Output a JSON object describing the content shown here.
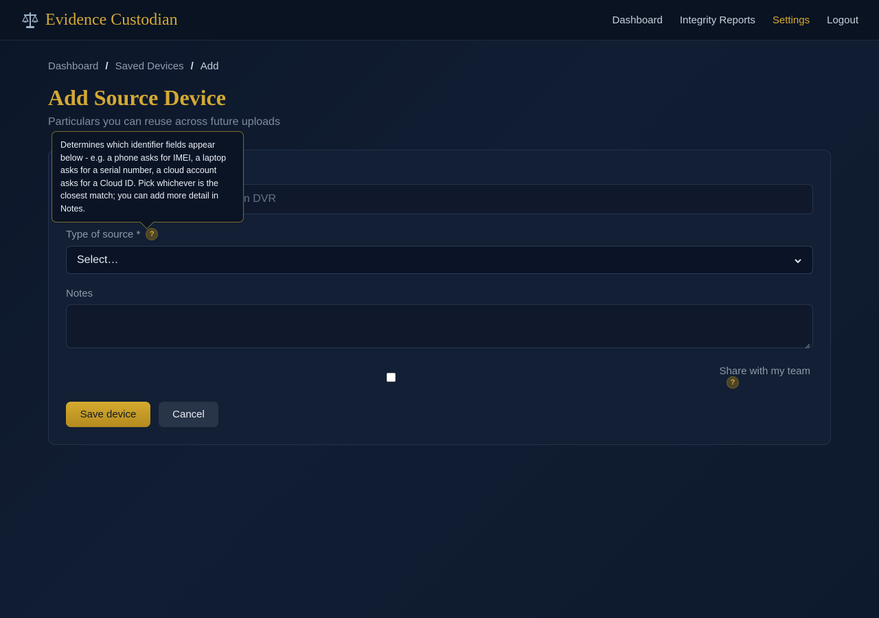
{
  "app": {
    "name": "Evidence Custodian",
    "brand_icon": "scales-icon",
    "accent_color": "#d3a933"
  },
  "nav": {
    "items": [
      {
        "label": "Dashboard"
      },
      {
        "label": "Integrity Reports"
      },
      {
        "label": "Settings",
        "active": true
      },
      {
        "label": "Logout"
      }
    ]
  },
  "breadcrumb": {
    "items": [
      "Dashboard",
      "Saved Devices"
    ],
    "current": "Add",
    "separator": "/"
  },
  "page": {
    "title": "Add Source Device",
    "subtitle": "Particulars you can reuse across future uploads"
  },
  "form": {
    "name_placeholder_visible": "tion DVR",
    "type_label": "Type of source *",
    "type_selected": "Select…",
    "notes_label": "Notes",
    "share_label": "Share with my team",
    "share_checked": false,
    "help_glyph": "?",
    "save_label": "Save device",
    "cancel_label": "Cancel"
  },
  "tooltip": {
    "text": "Determines which identifier fields appear below - e.g. a phone asks for IMEI, a laptop asks for a serial number, a cloud account asks for a Cloud ID. Pick whichever is the closest match; you can add more detail in Notes."
  }
}
